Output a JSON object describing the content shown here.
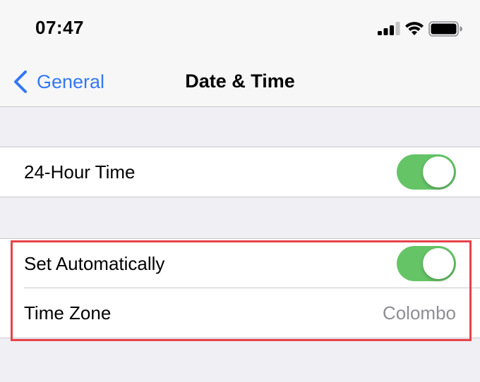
{
  "status_bar": {
    "time": "07:47",
    "icons": [
      "signal-icon",
      "wifi-icon",
      "battery-icon"
    ]
  },
  "nav": {
    "back_label": "General",
    "back_icon": "chevron-left-icon",
    "title": "Date & Time"
  },
  "groups": [
    {
      "rows": [
        {
          "label": "24-Hour Time",
          "toggle": true
        }
      ]
    },
    {
      "rows": [
        {
          "label": "Set Automatically",
          "toggle": true
        },
        {
          "label": "Time Zone",
          "value": "Colombo"
        }
      ]
    }
  ],
  "colors": {
    "accent": "#3478f6",
    "toggle_on": "#65c466",
    "highlight": "#e8424a",
    "background": "#efeff4"
  }
}
